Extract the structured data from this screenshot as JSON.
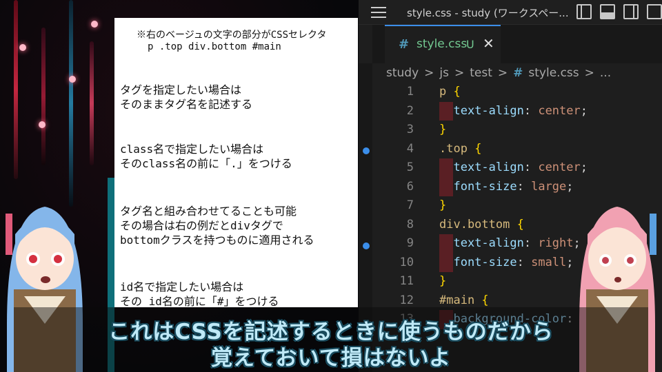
{
  "notes": {
    "header_line1": "※右のベージュの文字の部分がCSSセレクタ",
    "header_line2": "p  .top  div.bottom  #main",
    "para1": "タグを指定したい場合は\nそのままタグ名を記述する",
    "para2": "class名で指定したい場合は\nそのclass名の前に「.」をつける",
    "para3": "タグ名と組み合わせてることも可能\nその場合は右の例だとdivタグで\nbottomクラスを持つものに適用される",
    "para4": "id名で指定したい場合は\nその id名の前に「#」をつける"
  },
  "editor": {
    "window_title": "style.css - study (ワークスペー...",
    "tab": {
      "icon": "#",
      "name": "style.css",
      "status": "U",
      "close": "✕"
    },
    "breadcrumb": [
      "study",
      "js",
      "test",
      "style.css",
      "..."
    ],
    "breadcrumb_sep": ">",
    "lines": [
      {
        "n": "1",
        "sel": "p",
        "brace": " {"
      },
      {
        "n": "2",
        "prop": "text-align",
        "val": "center"
      },
      {
        "n": "3",
        "close": "}"
      },
      {
        "n": "4",
        "sel": ".top",
        "brace": " {"
      },
      {
        "n": "5",
        "prop": "text-align",
        "val": "center"
      },
      {
        "n": "6",
        "prop": "font-size",
        "val": "large"
      },
      {
        "n": "7",
        "close": "}"
      },
      {
        "n": "8",
        "sel": "div.bottom",
        "brace": " {"
      },
      {
        "n": "9",
        "prop": "text-align",
        "val": "right"
      },
      {
        "n": "10",
        "prop": "font-size",
        "val": "small"
      },
      {
        "n": "11",
        "close": "}"
      },
      {
        "n": "12",
        "sel": "#main",
        "brace": " {"
      },
      {
        "n": "13",
        "prop": "background-color",
        "val": ""
      }
    ]
  },
  "subtitle": {
    "line1": "これはCSSを記述するときに使うものだから",
    "line2": "覚えておいて損はないよ"
  },
  "colors": {
    "selector": "#d7ba7d",
    "property": "#9cdcfe",
    "value": "#ce9178",
    "accent_tab": "#3b8eea",
    "untracked": "#73c991"
  }
}
